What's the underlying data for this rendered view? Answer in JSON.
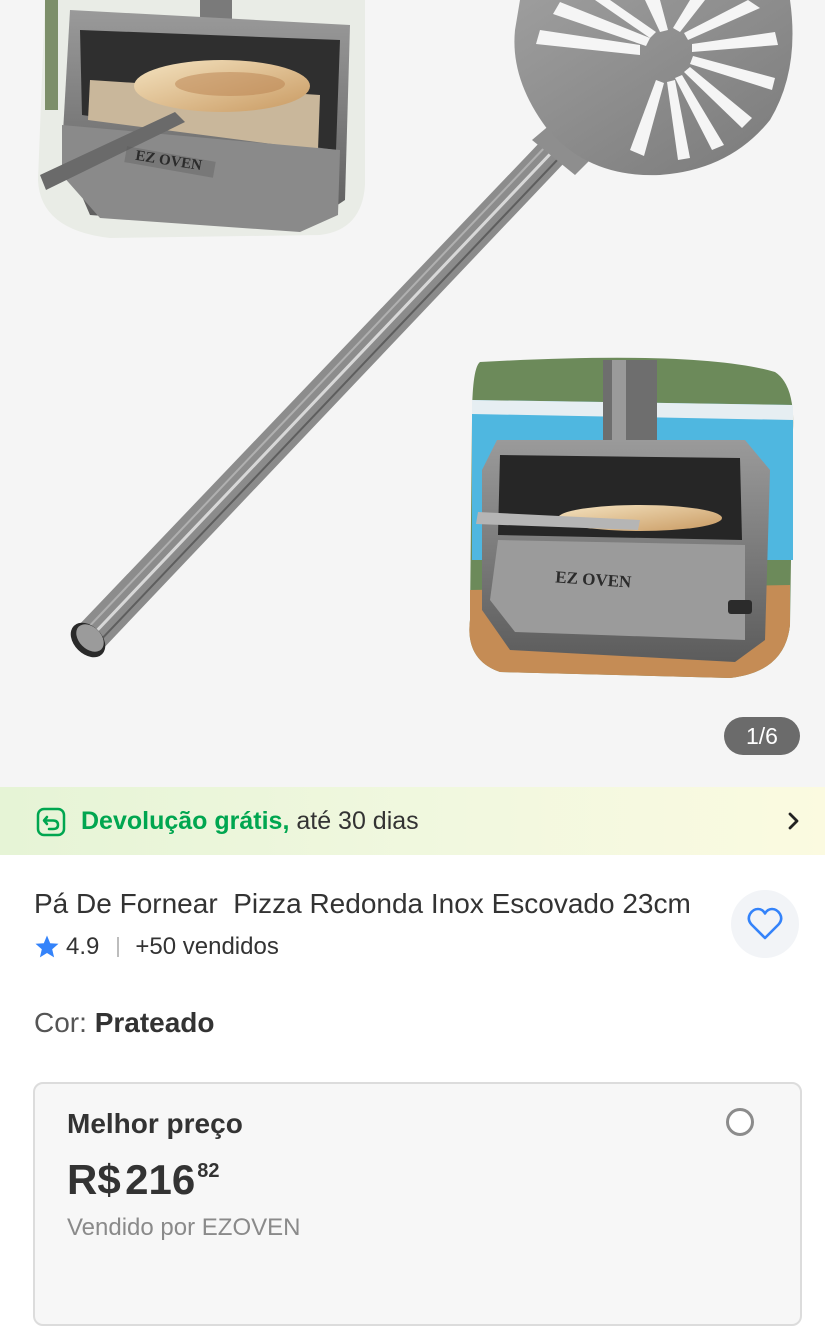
{
  "gallery": {
    "images_alt": [
      "Pá de fornear pizza redonda",
      "Forno com pizza",
      "Forno EZOVEN com pizza"
    ],
    "oven_logo_text": "EZ OVEN",
    "counter": "1/6"
  },
  "return_banner": {
    "strong_text": "Devolução grátis,",
    "rest_text": " até 30 dias",
    "icon": "return-arrow-icon",
    "chevron": "chevron-right-icon",
    "accent": "#00a650"
  },
  "product": {
    "title": "Pá De Fornear  Pizza Redonda Inox Escovado 23cm",
    "rating": "4.9",
    "sold": "+50 vendidos",
    "star_color": "#3483fa",
    "favorite_icon": "heart-outline-icon",
    "color_label": "Cor:",
    "color_value": "Prateado"
  },
  "offer": {
    "label": "Melhor preço",
    "currency": "R$",
    "price_integer": "216",
    "price_cents": "82",
    "seller": "Vendido por EZOVEN",
    "selected": false
  }
}
